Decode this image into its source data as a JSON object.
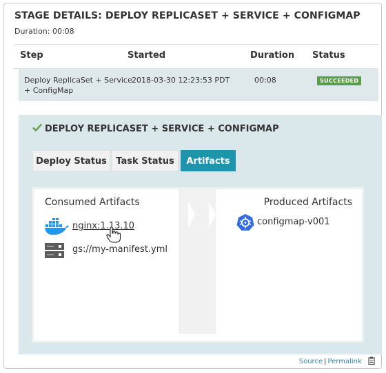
{
  "stage": {
    "title": "STAGE DETAILS: DEPLOY REPLICASET + SERVICE + CONFIGMAP",
    "duration_label": "Duration: 00:08"
  },
  "table": {
    "headers": [
      "Step",
      "Started",
      "Duration",
      "Status"
    ],
    "rows": [
      {
        "step_line1": "Deploy ReplicaSet + Service",
        "step_line2": "+ ConfigMap",
        "started": "2018-03-30 12:23:53 PDT",
        "duration": "00:08",
        "status": "SUCCEEDED"
      }
    ]
  },
  "details": {
    "title": "DEPLOY REPLICASET + SERVICE + CONFIGMAP",
    "tabs": [
      {
        "label": "Deploy Status",
        "active": false
      },
      {
        "label": "Task Status",
        "active": false
      },
      {
        "label": "Artifacts",
        "active": true
      }
    ],
    "consumed": {
      "heading": "Consumed Artifacts",
      "items": [
        {
          "icon": "docker-icon",
          "label": "nginx:1.13.10"
        },
        {
          "icon": "server-icon",
          "label": "gs://my-manifest.yml"
        }
      ]
    },
    "produced": {
      "heading": "Produced Artifacts",
      "items": [
        {
          "icon": "kubernetes-icon",
          "label": "configmap-v001"
        }
      ]
    }
  },
  "footer": {
    "source": "Source",
    "permalink": "Permalink"
  },
  "colors": {
    "accent": "#1f94ae",
    "success": "#5a9c4a",
    "panel": "#dbe8eb",
    "link": "#2e89b1"
  }
}
